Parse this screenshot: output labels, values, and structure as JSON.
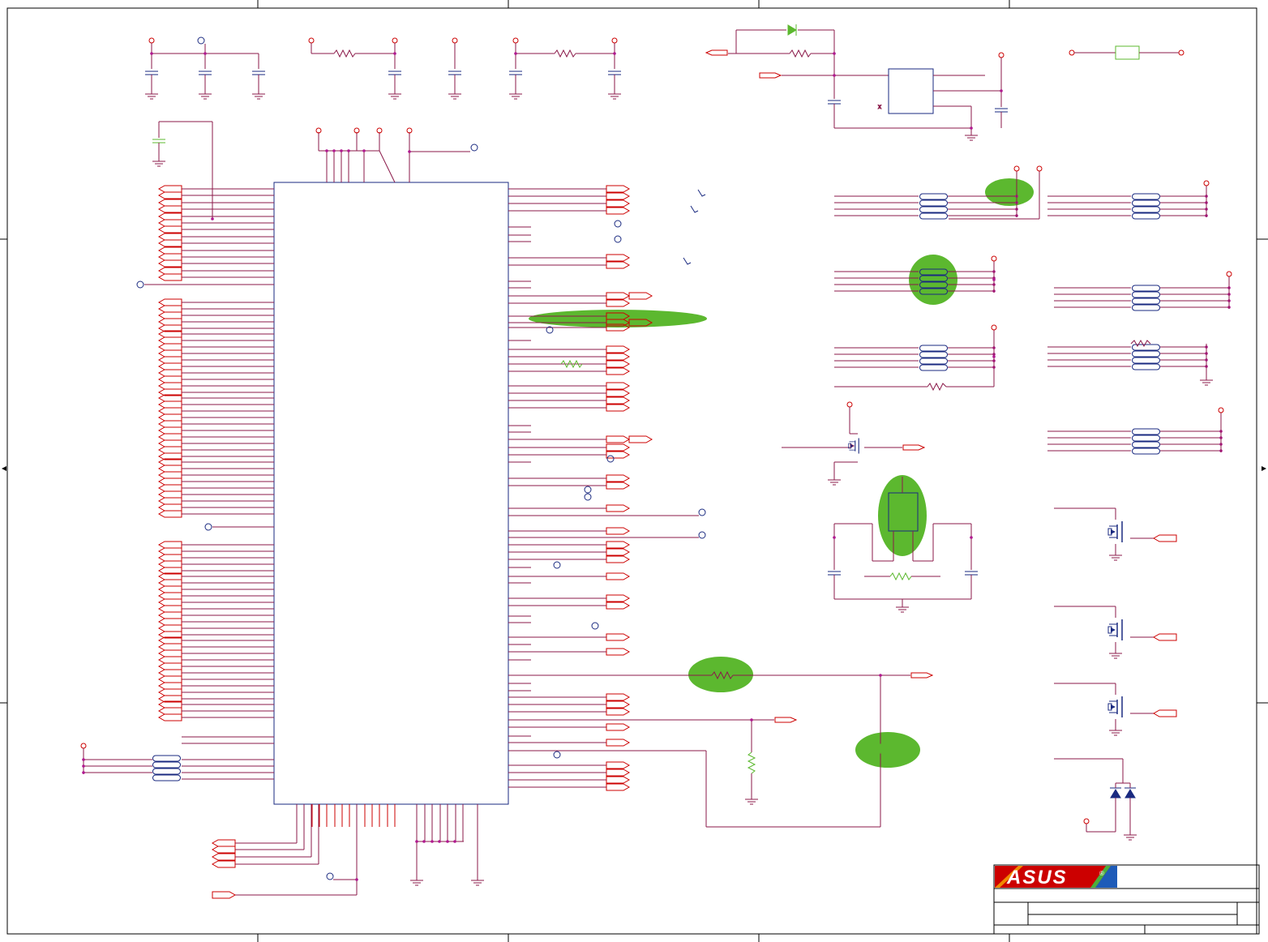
{
  "document": {
    "brand_logo": "ASUS",
    "registered_mark": "®"
  },
  "colors": {
    "wire": "#8b1a4a",
    "pin": "#cc0000",
    "component": "#1a2a80",
    "junction": "#b01890",
    "highlight": "#5cb82f",
    "frame": "#000000",
    "logo_bg": "#cc0000",
    "logo_stripe_orange": "#f08a00",
    "logo_stripe_green": "#4cae3c",
    "logo_stripe_blue": "#1e5bb8"
  },
  "icons": {
    "ground": "ground-icon",
    "resistor": "resistor-icon",
    "capacitor": "capacitor-icon",
    "diode": "diode-icon",
    "mosfet": "mosfet-icon",
    "port": "net-port-icon",
    "test_point": "test-point-icon",
    "resistor_pack": "resistor-pack-icon",
    "main_ic": "main-ic-icon"
  },
  "highlights_count": 7
}
